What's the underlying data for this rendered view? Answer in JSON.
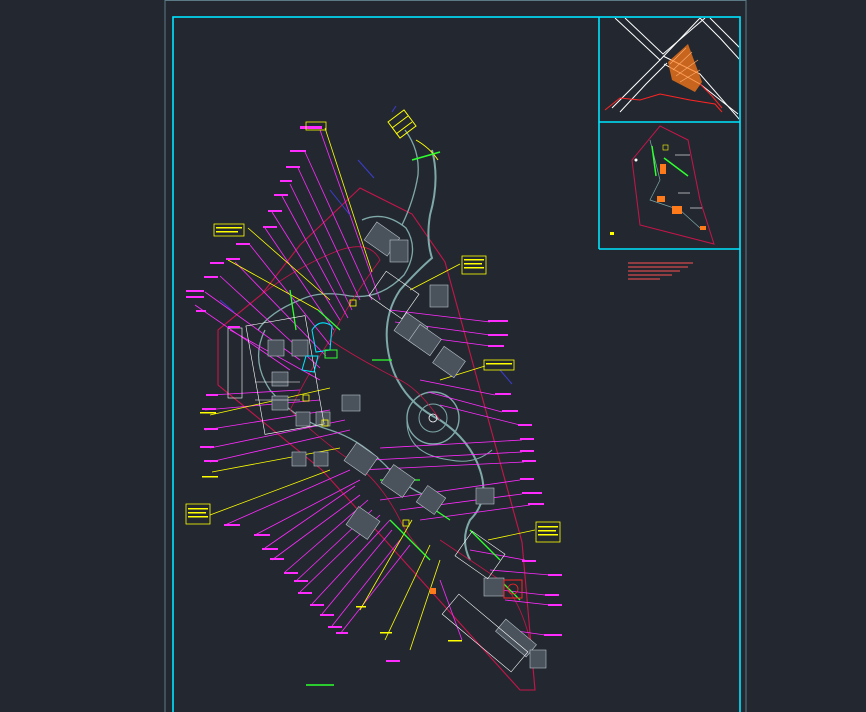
{
  "colors": {
    "background": "#232830",
    "frame": "#00e5ff",
    "sheet_outer": "#9aa4b0",
    "magenta": "#ff2bff",
    "yellow": "#ffff00",
    "green": "#2eff2e",
    "red": "#ff2424",
    "crimson": "#c8144a",
    "white": "#ffffff",
    "gray_teal": "#7fa8a8",
    "navy": "#3c3cd0",
    "orange": "#ff7a1a",
    "notes_red": "#ff5050"
  },
  "notes_block": {
    "line_count": 5,
    "description_visible": false
  },
  "icons": [
    "layout-grid-icon"
  ]
}
